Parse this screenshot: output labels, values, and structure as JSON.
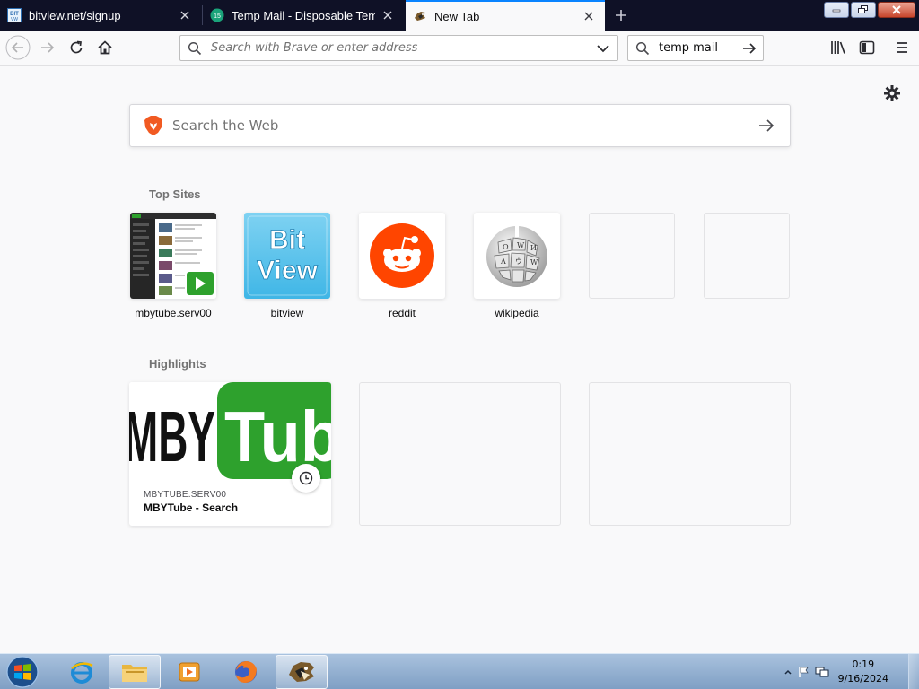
{
  "tabs": [
    {
      "title": "bitview.net/signup",
      "favicon": "bitview-favicon"
    },
    {
      "title": "Temp Mail - Disposable Tempo",
      "favicon": "tempmail-favicon"
    },
    {
      "title": "New Tab",
      "favicon": "brave-lion-favicon"
    }
  ],
  "toolbar": {
    "url_placeholder": "Search with Brave or enter address",
    "search_value": "temp mail"
  },
  "content": {
    "web_search_placeholder": "Search the Web",
    "top_sites_title": "Top Sites",
    "top_sites": [
      {
        "label": "mbytube.serv00"
      },
      {
        "label": "bitview"
      },
      {
        "label": "reddit"
      },
      {
        "label": "wikipedia"
      },
      {
        "label": ""
      },
      {
        "label": ""
      }
    ],
    "highlights_title": "Highlights",
    "highlight": {
      "host": "MBYTUBE.SERV00",
      "title": "MBYTube - Search",
      "thumb_text_left": "MBY",
      "thumb_text_right": "Tub"
    },
    "bitview_logo_line1": "Bit",
    "bitview_logo_line2": "View"
  },
  "taskbar": {
    "time": "0:19",
    "date": "9/16/2024"
  },
  "colors": {
    "tabstrip": "#0f1126",
    "accent": "#0a84ff",
    "reddit": "#ff4500",
    "bitview": "#3fb6e6",
    "mbytube_green": "#2ea12d"
  }
}
